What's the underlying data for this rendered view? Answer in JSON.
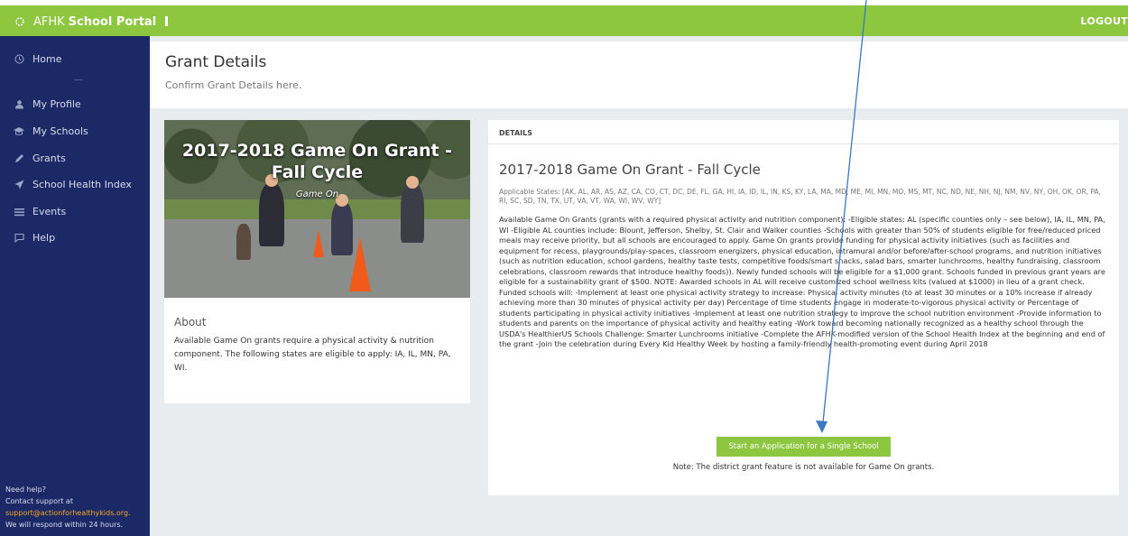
{
  "topbar": {
    "brand_prefix": "AFHK",
    "brand_name": "School Portal",
    "logout_label": "LOGOUT"
  },
  "sidebar": {
    "items": [
      {
        "label": "Home",
        "icon": "clock-icon"
      },
      {
        "label": "My Profile",
        "icon": "user-icon"
      },
      {
        "label": "My Schools",
        "icon": "school-icon"
      },
      {
        "label": "Grants",
        "icon": "pencil-icon"
      },
      {
        "label": "School Health Index",
        "icon": "paper-plane-icon"
      },
      {
        "label": "Events",
        "icon": "list-icon"
      },
      {
        "label": "Help",
        "icon": "chat-icon"
      }
    ],
    "help": {
      "line1": "Need help?",
      "line2": "Contact support at",
      "email": "support@actionforhealthykids.org.",
      "line3": "We will respond within 24 hours."
    }
  },
  "header": {
    "title": "Grant Details",
    "subtitle": "Confirm Grant Details here."
  },
  "left_card": {
    "image_title": "2017-2018 Game On Grant - Fall Cycle",
    "image_subtitle": "Game On",
    "about_heading": "About",
    "about_text": "Available Game On grants require a physical activity & nutrition component. The following states are eligible to apply: IA, IL, MN, PA, WI."
  },
  "details": {
    "section_label": "DETAILS",
    "grant_title": "2017-2018 Game On Grant - Fall Cycle",
    "states": "Applicable States: [AK, AL, AR, AS, AZ, CA, CO, CT, DC, DE, FL, GA, HI, IA, ID, IL, IN, KS, KY, LA, MA, MD, ME, MI, MN, MO, MS, MT, NC, ND, NE, NH, NJ, NM, NV, NY, OH, OK, OR, PA, RI, SC, SD, TN, TX, UT, VA, VT, WA, WI, WV, WY]",
    "description": "Available Game On Grants (grants with a required physical activity and nutrition component): -Eligible states: AL (specific counties only – see below), IA, IL, MN, PA, WI -Eligible AL counties include: Blount, Jefferson, Shelby, St. Clair and Walker counties -Schools with greater than 50% of students eligible for free/reduced priced meals may receive priority, but all schools are encouraged to apply. Game On grants provide funding for physical activity initiatives (such as facilities and equipment for recess, playgrounds/play-spaces, classroom energizers, physical education, intramural and/or before/after-school programs, and nutrition initiatives (such as nutrition education, school gardens, healthy taste tests, competitive foods/smart snacks, salad bars, smarter lunchrooms, healthy fundraising, classroom celebrations, classroom rewards that introduce healthy foods)). Newly funded schools will be eligible for a $1,000 grant. Schools funded in previous grant years are eligible for a sustainability grant of $500. NOTE: Awarded schools in AL will receive customized school wellness kits (valued at $1000) in lieu of a grant check. Funded schools will: -Implement at least one physical activity strategy to increase: Physical activity minutes (to at least 30 minutes or a 10% increase if already achieving more than 30 minutes of physical activity per day) Percentage of time students engage in moderate-to-vigorous physical activity or Percentage of students participating in physical activity initiatives -Implement at least one nutrition strategy to improve the school nutrition environment -Provide information to students and parents on the importance of physical activity and healthy eating -Work toward becoming nationally recognized as a healthy school through the USDA's HealthierUS Schools Challenge: Smarter Lunchrooms initiative -Complete the AFHK-modified version of the School Health Index at the beginning and end of the grant -Join the celebration during Every Kid Healthy Week by hosting a family-friendly health-promoting event during April 2018",
    "apply_button": "Start an Application for a Single School",
    "note": "Note: The district grant feature is not available for Game On grants."
  },
  "colors": {
    "accent": "#8dc63f",
    "sidebar_bg": "#1b2a67",
    "annotation_arrow": "#3a78c2"
  }
}
